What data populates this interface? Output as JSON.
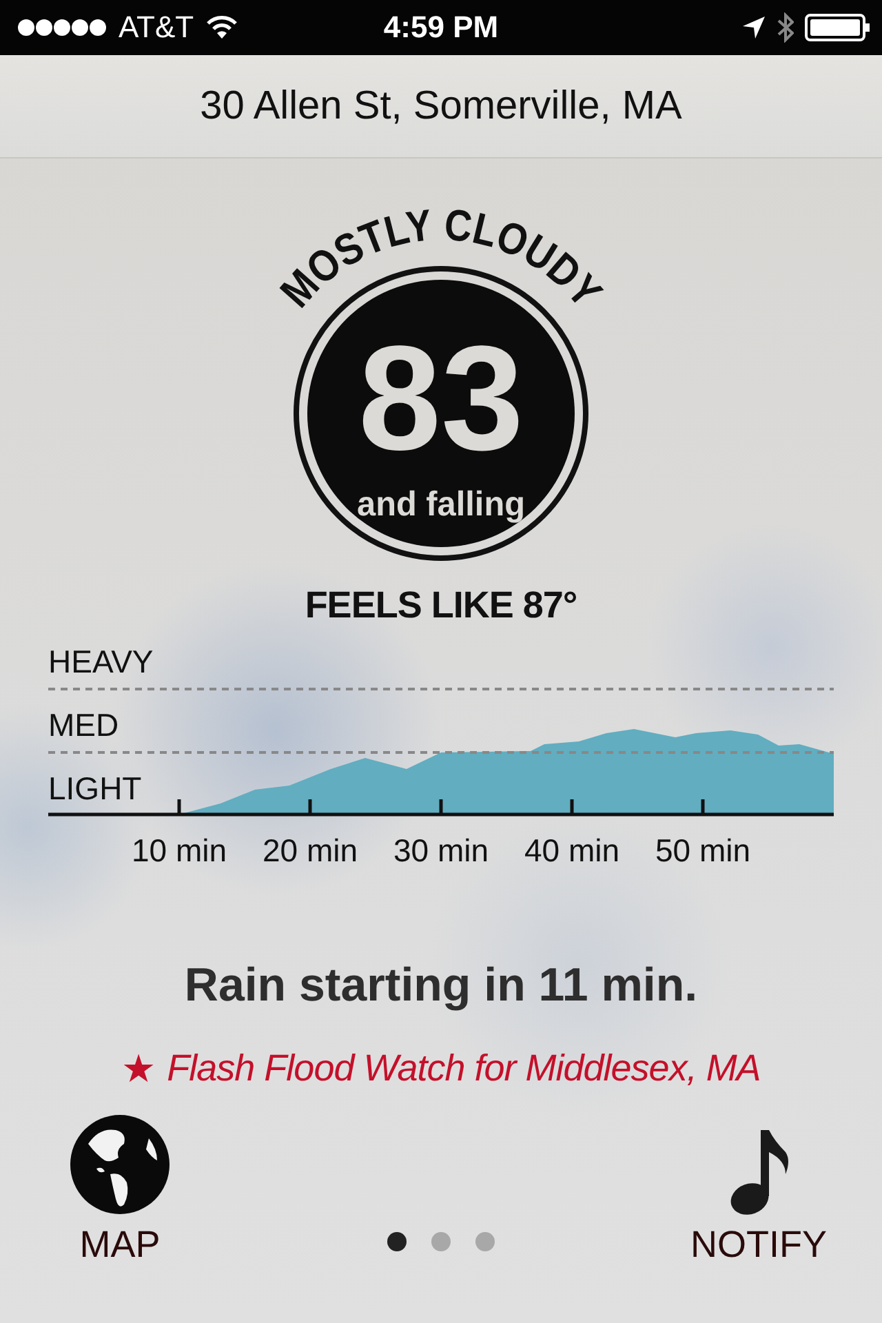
{
  "status_bar": {
    "carrier": "AT&T",
    "time": "4:59 PM"
  },
  "location": "30 Allen St, Somerville, MA",
  "condition": "MOSTLY CLOUDY",
  "temperature": "83",
  "trend": "and falling",
  "feels_like": "FEELS LIKE 87°",
  "precipitation": {
    "levels": [
      "HEAVY",
      "MED",
      "LIGHT"
    ],
    "time_labels": [
      "10 min",
      "20 min",
      "30 min",
      "40 min",
      "50 min"
    ]
  },
  "forecast": "Rain starting in 11 min.",
  "alert": {
    "icon": "★",
    "text": "Flash Flood Watch for Middlesex, MA"
  },
  "buttons": [
    {
      "kind": "map",
      "label": "MAP"
    },
    {
      "kind": "notify",
      "label": "NOTIFY"
    }
  ],
  "pages": [
    {
      "selected": true
    },
    {
      "selected": false
    },
    {
      "selected": false
    }
  ]
}
